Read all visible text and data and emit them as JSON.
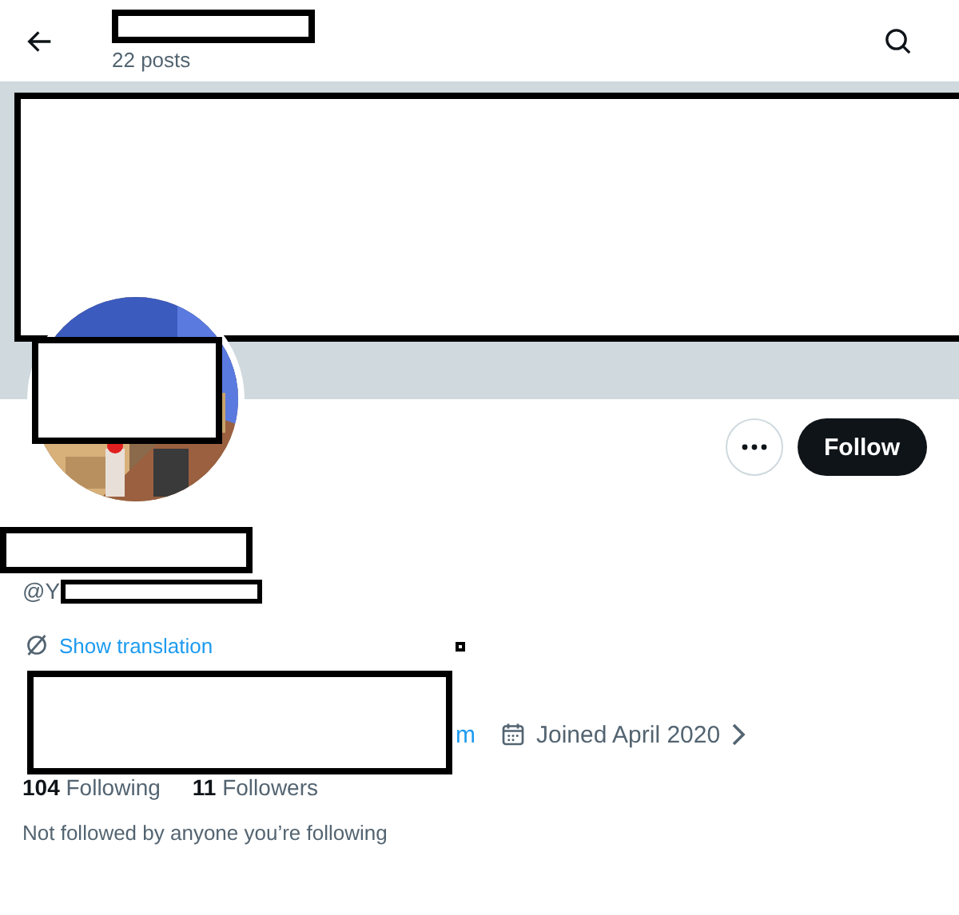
{
  "header": {
    "title_redacted": true,
    "post_count": "22 posts"
  },
  "banner": {
    "redacted": true
  },
  "avatar": {
    "kind": "picture",
    "redacted": true
  },
  "actions": {
    "follow_label": "Follow"
  },
  "profile": {
    "name_redacted": true,
    "handle": "@Y",
    "handle_redacted": true,
    "translation_link": "Show translation",
    "bio_redacted": true,
    "website_fragment": "m",
    "joined": "Joined April 2020",
    "stats": [
      {
        "count": "104",
        "label": "Following"
      },
      {
        "count": "11",
        "label": "Followers"
      }
    ],
    "followed_by": "Not followed by anyone you’re following"
  }
}
